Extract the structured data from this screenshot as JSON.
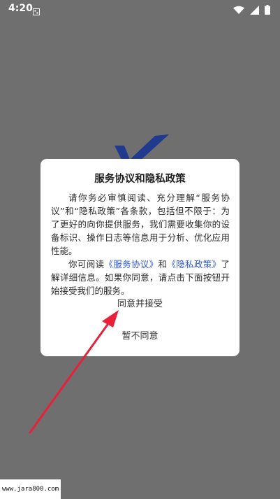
{
  "status_bar": {
    "time": "4:20",
    "icons": [
      "notification-icon",
      "wifi-icon",
      "signal-icon",
      "battery-icon"
    ]
  },
  "dialog": {
    "title": "服务协议和隐私政策",
    "para1": "请你务必审慎阅读、充分理解“服务协议”和“隐私政策”各条款，包括但不限于：为了更好的向你提供服务，我们需要收集你的设备标识、操作日志等信息用于分析、优化应用性能。",
    "para2_prefix": "你可阅读",
    "service_link": "《服务协议》",
    "para2_and": "和",
    "privacy_link": "《隐私政策》",
    "para2_suffix": "了解详细信息。如果你同意，请点击下面按钮开始接受我们的服务。",
    "agree_label": "同意并接受",
    "disagree_label": "暂不同意"
  },
  "watermark": "www.jara800.com",
  "colors": {
    "overlay": "#6f6f6f",
    "link": "#2d59d6",
    "arrow": "#e8203a",
    "logo": "#1f3a8f"
  }
}
